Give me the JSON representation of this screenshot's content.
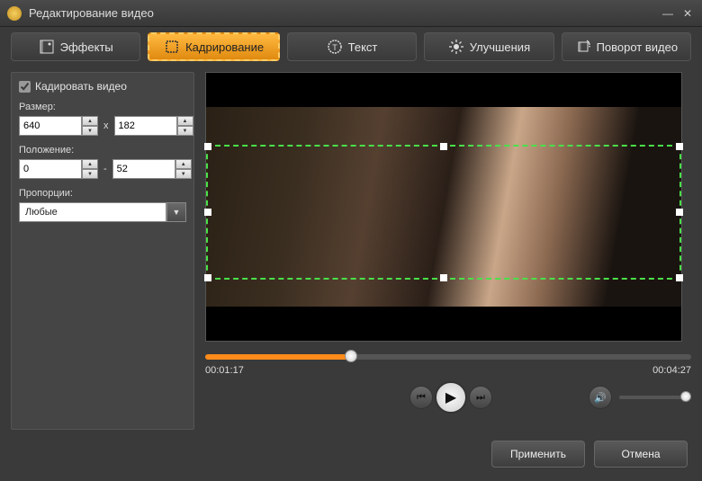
{
  "window": {
    "title": "Редактирование видео"
  },
  "tabs": {
    "effects": "Эффекты",
    "crop": "Кадрирование",
    "text": "Текст",
    "enhance": "Улучшения",
    "rotate": "Поворот видео"
  },
  "sidebar": {
    "crop_video": "Кадировать видео",
    "size_label": "Размер:",
    "size_w": "640",
    "size_h": "182",
    "size_sep": "x",
    "pos_label": "Положение:",
    "pos_x": "0",
    "pos_y": "52",
    "pos_sep": "-",
    "ratio_label": "Пропорции:",
    "ratio_value": "Любые"
  },
  "player": {
    "current_time": "00:01:17",
    "total_time": "00:04:27"
  },
  "footer": {
    "apply": "Применить",
    "cancel": "Отмена"
  }
}
